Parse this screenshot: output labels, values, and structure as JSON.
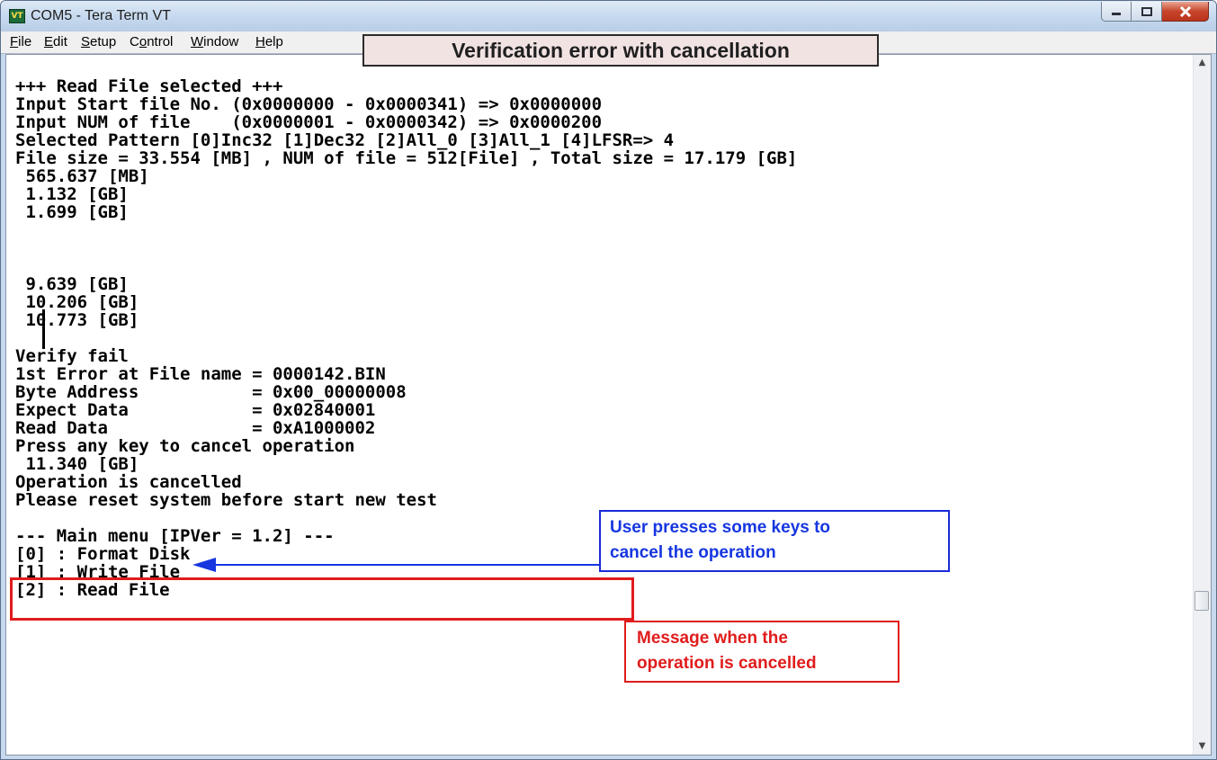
{
  "window": {
    "title": "COM5 - Tera Term VT",
    "app_icon": "tera-term-icon"
  },
  "menu": {
    "items": [
      "File",
      "Edit",
      "Setup",
      "Control",
      "Window",
      "Help"
    ],
    "mnemonics": [
      "F",
      "E",
      "S",
      "o",
      "W",
      "H"
    ]
  },
  "annotations": {
    "banner": "Verification error with cancellation",
    "user_keys_line1": "User presses some keys to",
    "user_keys_line2": "cancel the operation",
    "cancel_msg_line1": "Message when the",
    "cancel_msg_line2": "operation is cancelled",
    "colors": {
      "blue": "#1636e0",
      "red": "#e01c1c"
    }
  },
  "terminal": {
    "lines": [
      "+++ Read File selected +++",
      "Input Start file No. (0x0000000 - 0x0000341) => 0x0000000",
      "Input NUM of file    (0x0000001 - 0x0000342) => 0x0000200",
      "Selected Pattern [0]Inc32 [1]Dec32 [2]All_0 [3]All_1 [4]LFSR=> 4",
      "File size = 33.554 [MB] , NUM of file = 512[File] , Total size = 17.179 [GB]",
      " 565.637 [MB]",
      " 1.132 [GB]",
      " 1.699 [GB]",
      "",
      "",
      "",
      " 9.639 [GB]",
      " 10.206 [GB]",
      " 10.773 [GB]",
      "",
      "Verify fail",
      "1st Error at File name = 0000142.BIN",
      "Byte Address           = 0x00_00000008",
      "Expect Data            = 0x02840001",
      "Read Data              = 0xA1000002",
      "Press any key to cancel operation",
      " 11.340 [GB]",
      "Operation is cancelled",
      "Please reset system before start new test",
      "",
      "--- Main menu [IPVer = 1.2] ---",
      "[0] : Format Disk",
      "[1] : Write File",
      "[2] : Read File"
    ]
  }
}
